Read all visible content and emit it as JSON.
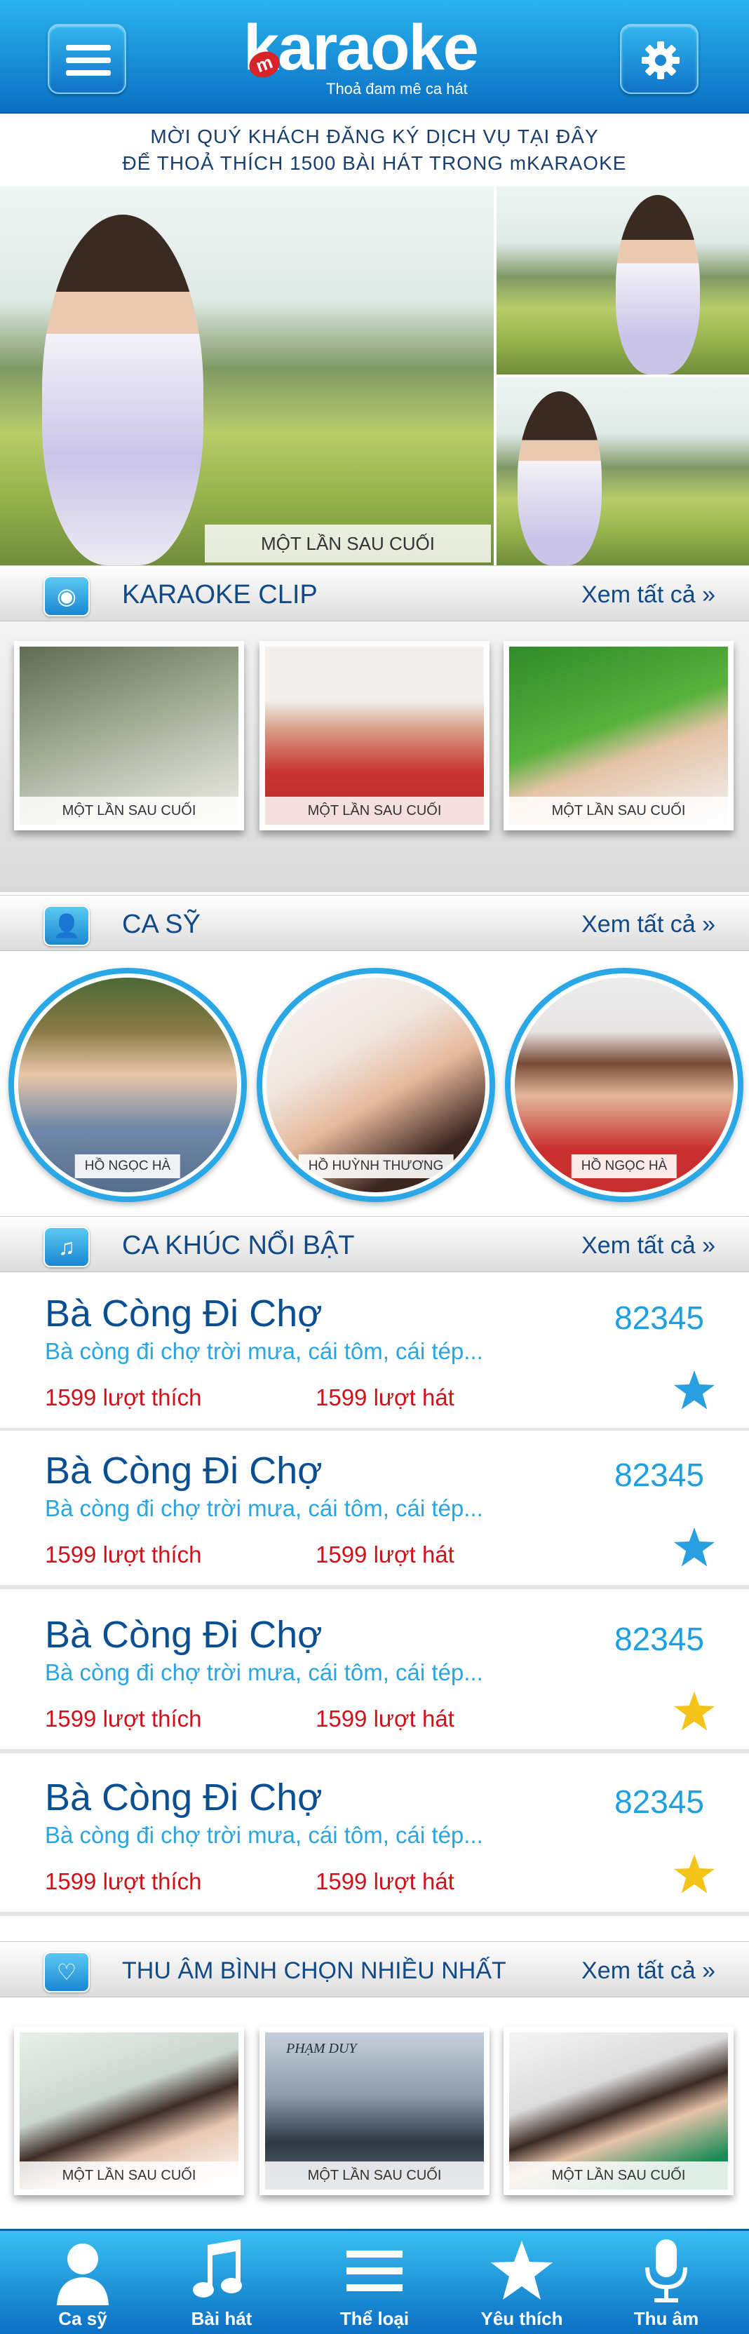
{
  "header": {
    "logo_text": "karaoke",
    "logo_badge": "m",
    "slogan": "Thoả đam mê ca hát",
    "menu_icon": "hamburger-icon",
    "settings_icon": "gear-icon"
  },
  "promo": {
    "line1": "MỜI QUÝ KHÁCH ĐĂNG KÝ DỊCH VỤ TẠI ĐÂY",
    "line2": "ĐỂ THOẢ THÍCH 1500 BÀI HÁT TRONG mKARAOKE"
  },
  "hero": {
    "caption": "MỘT LẦN SAU CUỐI"
  },
  "karaoke_clip": {
    "title": "KARAOKE CLIP",
    "see_all": "Xem tất cả",
    "icon": "disc-icon",
    "items": [
      {
        "caption": "MỘT LẦN SAU CUỐI"
      },
      {
        "caption": "MỘT LẦN SAU CUỐI"
      },
      {
        "caption": "MỘT LẦN SAU CUỐI"
      }
    ]
  },
  "singers": {
    "title": "CA SỸ",
    "see_all": "Xem tất cả",
    "icon": "person-icon",
    "items": [
      {
        "name": "HỒ NGỌC HÀ"
      },
      {
        "name": "HỒ HUỲNH THƯƠNG"
      },
      {
        "name": "HỒ NGỌC HÀ"
      }
    ]
  },
  "featured_songs": {
    "title": "CA KHÚC NỔI BẬT",
    "see_all": "Xem tất cả",
    "icon": "music-note-icon",
    "items": [
      {
        "title": "Bà Còng Đi Chợ",
        "code": "82345",
        "lyrics": "Bà còng đi chợ trời mưa, cái tôm, cái tép...",
        "likes": "1599 lượt thích",
        "plays": "1599 lượt hát",
        "star_color": "#2a9fe0"
      },
      {
        "title": "Bà Còng Đi Chợ",
        "code": "82345",
        "lyrics": "Bà còng đi chợ trời mưa, cái tôm, cái tép...",
        "likes": "1599 lượt thích",
        "plays": "1599 lượt hát",
        "star_color": "#2a9fe0"
      },
      {
        "title": "Bà Còng Đi Chợ",
        "code": "82345",
        "lyrics": "Bà còng đi chợ trời mưa, cái tôm, cái tép...",
        "likes": "1599 lượt thích",
        "plays": "1599 lượt hát",
        "star_color": "#f2c418"
      },
      {
        "title": "Bà Còng Đi Chợ",
        "code": "82345",
        "lyrics": "Bà còng đi chợ trời mưa, cái tôm, cái tép...",
        "likes": "1599 lượt thích",
        "plays": "1599 lượt hát",
        "star_color": "#f2c418"
      }
    ]
  },
  "top_recordings": {
    "title": "THU ÂM BÌNH CHỌN NHIỀU NHẤT",
    "see_all": "Xem tất cả",
    "icon": "heart-icon",
    "items": [
      {
        "caption": "MỘT LẦN SAU CUỐI"
      },
      {
        "caption": "MỘT LẦN SAU CUỐI",
        "overlay": "PHẠM DUY"
      },
      {
        "caption": "MỘT LẦN SAU CUỐI"
      }
    ]
  },
  "tabbar": {
    "items": [
      {
        "label": "Ca sỹ",
        "icon": "singer-icon"
      },
      {
        "label": "Bài hát",
        "icon": "music-note-icon"
      },
      {
        "label": "Thể loại",
        "icon": "list-icon"
      },
      {
        "label": "Yêu thích",
        "icon": "star-icon"
      },
      {
        "label": "Thu âm",
        "icon": "microphone-icon"
      }
    ]
  },
  "colors": {
    "brand_blue": "#1a87d2",
    "title_blue": "#114a86",
    "accent_red": "#d0111a"
  }
}
